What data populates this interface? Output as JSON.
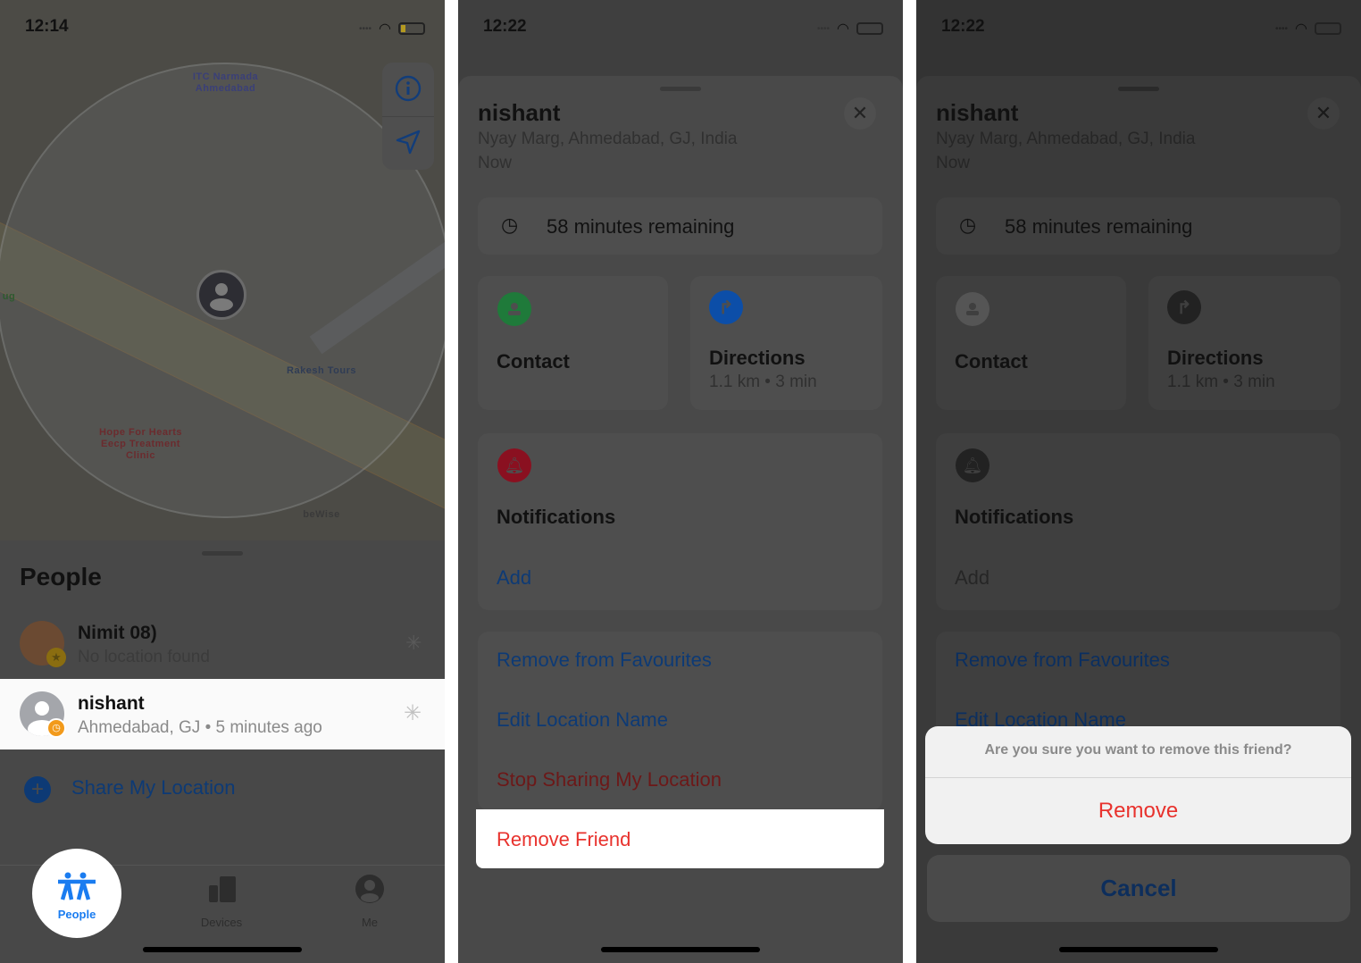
{
  "panel1": {
    "status_time": "12:14",
    "map_pois": [
      "ITC Narmada Ahmedabad",
      "Rakesh Tours",
      "Hope For Hearts Eecp Treatment Clinic",
      "beWise",
      "ug"
    ],
    "sheet_title": "People",
    "people": [
      {
        "name": "Nimit 08)",
        "subtitle": "No location found"
      },
      {
        "name": "nishant",
        "subtitle": "Ahmedabad, GJ • 5 minutes ago"
      }
    ],
    "share_label": "Share My Location",
    "tabs": [
      {
        "label": "People",
        "icon": "people-icon"
      },
      {
        "label": "Devices",
        "icon": "devices-icon"
      },
      {
        "label": "Me",
        "icon": "me-icon"
      }
    ],
    "active_tab": "People"
  },
  "detail": {
    "status_time": "12:22",
    "name": "nishant",
    "address": "Nyay Marg, Ahmedabad, GJ, India",
    "updated": "Now",
    "remaining": "58 minutes remaining",
    "contact_label": "Contact",
    "directions_label": "Directions",
    "directions_sub": "1.1 km • 3 min",
    "notifications_label": "Notifications",
    "notifications_add": "Add",
    "remove_favourites": "Remove from Favourites",
    "edit_location": "Edit Location Name",
    "stop_sharing": "Stop Sharing My Location",
    "remove_friend": "Remove Friend"
  },
  "alert": {
    "message": "Are you sure you want to remove this friend?",
    "remove_label": "Remove",
    "cancel_label": "Cancel"
  },
  "colors": {
    "accent": "#1a7cf0",
    "destructive": "#e8322d",
    "contact_green": "#1f7a3a",
    "directions_blue": "#0c4ea8",
    "notif_red": "#8a1020",
    "badge_orange": "#f29a1b"
  }
}
